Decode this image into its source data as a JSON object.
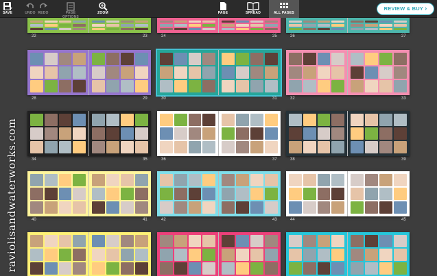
{
  "toolbar": {
    "save": "SAVE",
    "undo": "UNDO",
    "redo": "REDO",
    "page_options": "PAGE OPTIONS",
    "zoom": "ZOOM",
    "page": "PAGE",
    "spread": "SPREAD",
    "all_pages": "ALL PAGES",
    "review": "REVIEW & BUY",
    "icons": {
      "save": "floppy-disk-icon",
      "undo": "undo-arrow-icon",
      "redo": "redo-arrow-icon",
      "page_options": "page-options-icon",
      "zoom": "zoom-magnifier-icon",
      "page": "single-page-icon",
      "spread": "open-book-icon",
      "all_pages": "grid-icon",
      "review": "chevron-right-icon"
    }
  },
  "colors": {
    "accent": "#44c2d2",
    "toolbar": "#2b2b2b",
    "canvas": "#3d3d3d"
  },
  "watermark": "raviolisandwaterworks.com",
  "spreads": [
    {
      "left": "22",
      "right": "23",
      "theme": "#8bc34a"
    },
    {
      "left": "24",
      "right": "25",
      "theme": "#f06292"
    },
    {
      "left": "26",
      "right": "27",
      "theme": "#4db6ac"
    },
    {
      "left": "28",
      "right": "29",
      "theme": "#9575cd"
    },
    {
      "left": "30",
      "right": "31",
      "theme": "#26a69a"
    },
    {
      "left": "32",
      "right": "33",
      "theme": "#f48fb1"
    },
    {
      "left": "34",
      "right": "35",
      "theme": "#212121"
    },
    {
      "left": "36",
      "right": "37",
      "theme": "#ffffff"
    },
    {
      "left": "38",
      "right": "39",
      "theme": "#263238"
    },
    {
      "left": "40",
      "right": "41",
      "theme": "#fff59d"
    },
    {
      "left": "42",
      "right": "43",
      "theme": "#80deea"
    },
    {
      "left": "44",
      "right": "45",
      "theme": "#ffffff"
    },
    {
      "left": "",
      "right": "",
      "theme": "#fff176"
    },
    {
      "left": "",
      "right": "",
      "theme": "#ec407a"
    },
    {
      "left": "",
      "right": "",
      "theme": "#26c6da"
    }
  ]
}
